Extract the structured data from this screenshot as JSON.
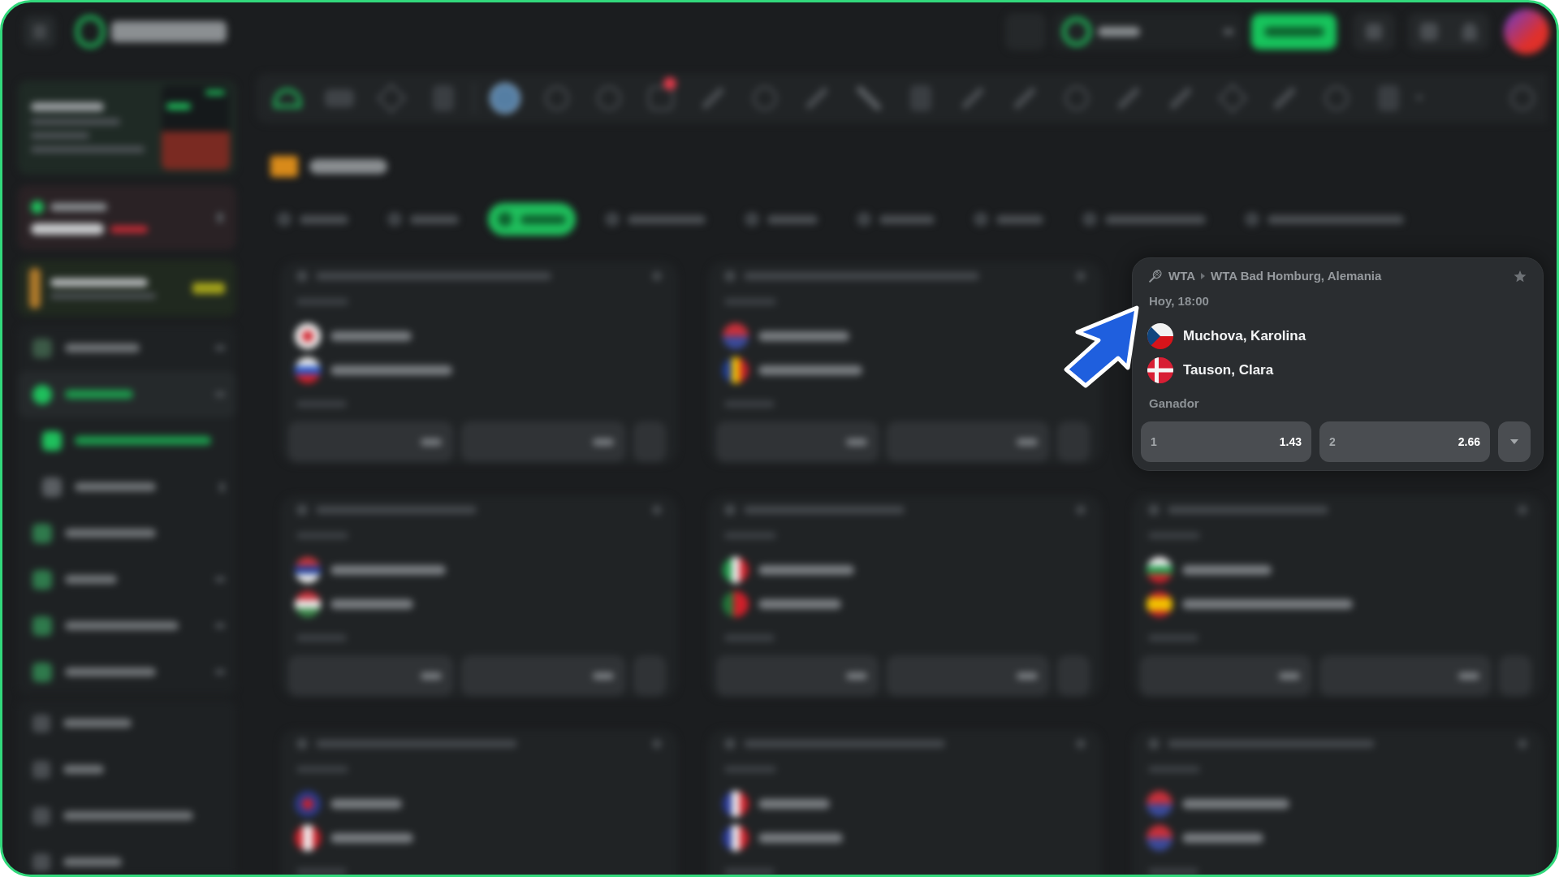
{
  "match_card": {
    "league": "WTA",
    "tournament": "WTA Bad Homburg, Alemania",
    "time": "Hoy, 18:00",
    "players": [
      {
        "name": "Muchova, Karolina",
        "kind": "czechia"
      },
      {
        "name": "Tauson, Clara",
        "kind": "denmark"
      }
    ],
    "market": "Ganador",
    "odds": [
      {
        "label": "1",
        "value": "1.43"
      },
      {
        "label": "2",
        "value": "2.66"
      }
    ]
  }
}
